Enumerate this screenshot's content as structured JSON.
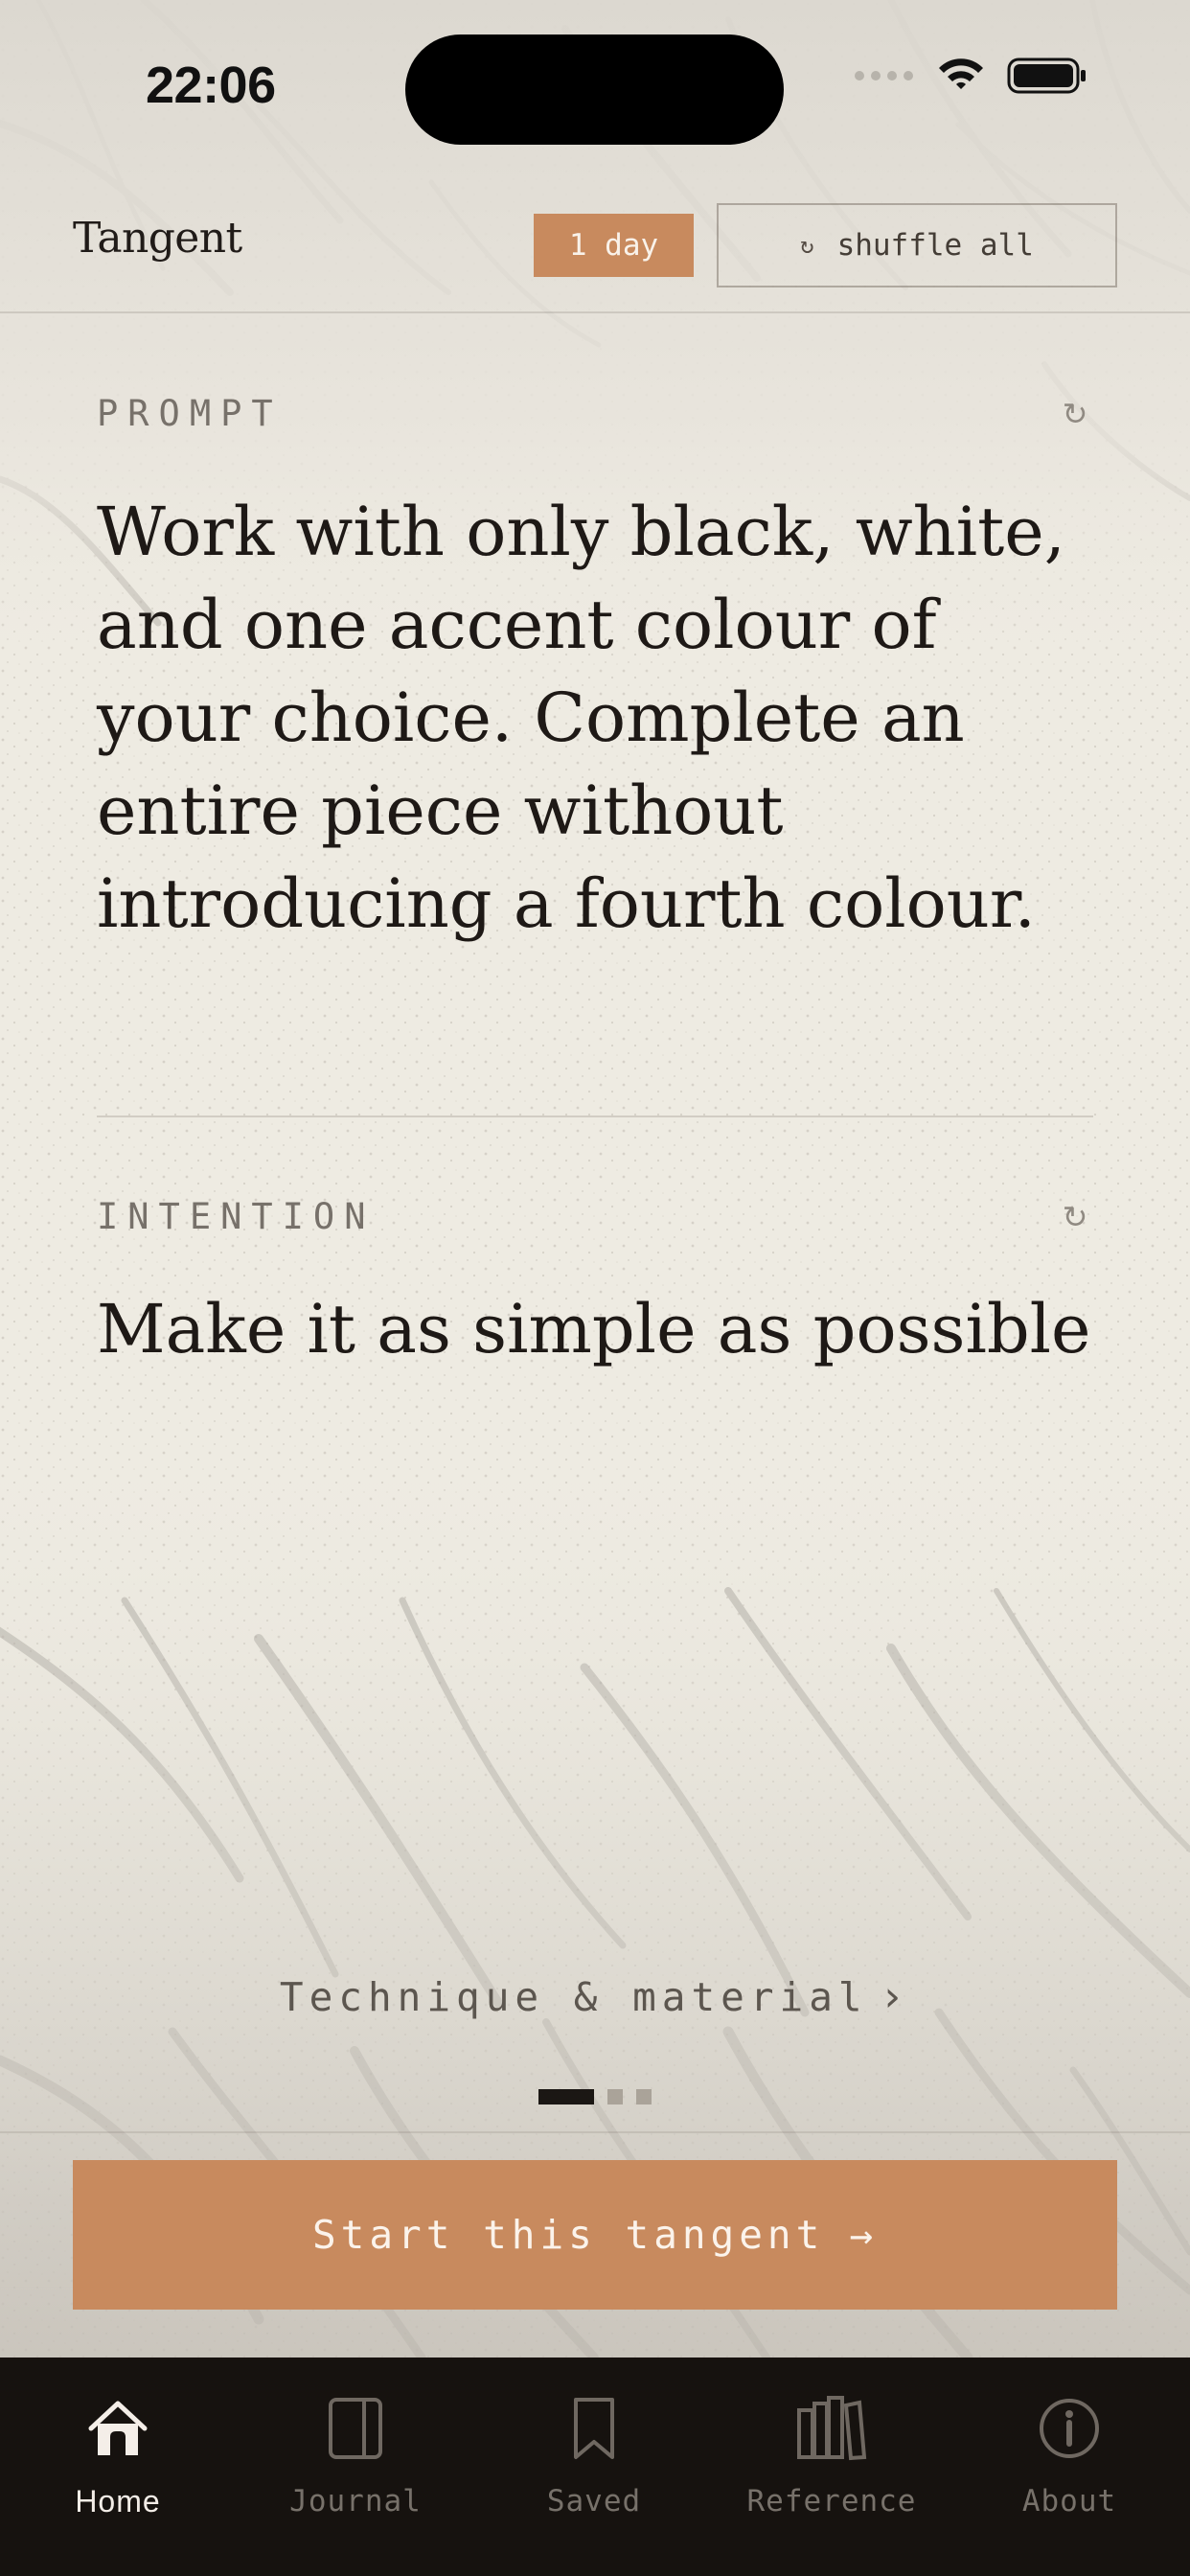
{
  "status_bar": {
    "time": "22:06",
    "wifi_icon": "wifi-icon",
    "battery_icon": "battery-icon",
    "signal_icon": "cell-signal-icon"
  },
  "header": {
    "app_name": "Tangent",
    "day_badge": "1 day",
    "shuffle_icon": "shuffle-icon",
    "shuffle_label": "shuffle all"
  },
  "prompt": {
    "label": "PROMPT",
    "text": "Work with only black, white, and one accent colour of your choice. Complete an entire piece without introducing a fourth colour.",
    "refresh_icon": "refresh-icon"
  },
  "intention": {
    "label": "INTENTION",
    "text": "Make it as simple as possible",
    "refresh_icon": "refresh-icon"
  },
  "technique": {
    "label": "Technique & material",
    "chevron": "›"
  },
  "page_indicator": {
    "current": 1,
    "total": 3
  },
  "cta": {
    "label": "Start this tangent",
    "arrow": "→"
  },
  "tabs": [
    {
      "label": "Home",
      "icon": "home-icon",
      "active": true
    },
    {
      "label": "Journal",
      "icon": "journal-icon",
      "active": false
    },
    {
      "label": "Saved",
      "icon": "bookmark-icon",
      "active": false
    },
    {
      "label": "Reference",
      "icon": "reference-icon",
      "active": false
    },
    {
      "label": "About",
      "icon": "info-icon",
      "active": false
    }
  ],
  "colors": {
    "background": "#eeebe2",
    "accent": "#c88a5e",
    "text": "#1e1916",
    "tab_bar": "#16120f"
  }
}
